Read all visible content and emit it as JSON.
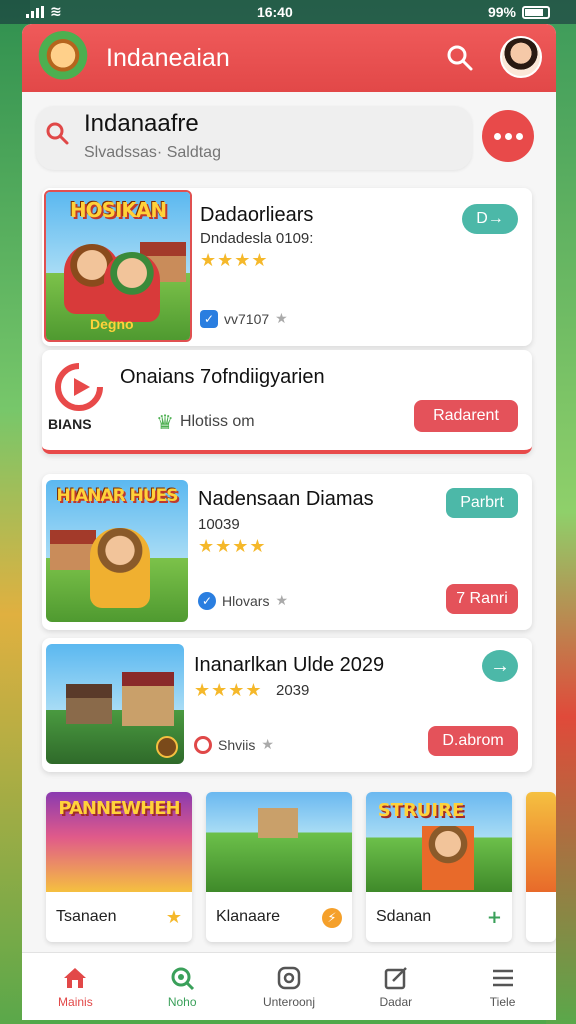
{
  "status": {
    "time": "16:40",
    "battery": "99%"
  },
  "header": {
    "title": "Indaneaian"
  },
  "search": {
    "title": "Indanaafre",
    "placeholder": "Slvadssas· Saldtag"
  },
  "cards": [
    {
      "banner": "HOSIKAN",
      "badge": "Degno",
      "title": "Dadaorliears",
      "subtitle": "Dndadesla 0109:",
      "rating": 4,
      "meta": "vv7107",
      "button": "D→"
    },
    {
      "logo_text": "BIANS",
      "title": "Onaians 7ofndiigyarien",
      "meta": "Hlotiss om",
      "button": "Radarent"
    },
    {
      "banner": "HIANAR HUES",
      "title": "Nadensaan Diamas",
      "subtitle": "10039",
      "rating": 4,
      "meta": "Hlovars",
      "button_top": "Parbrt",
      "button_bottom": "7 Ranri"
    },
    {
      "title": "Inanarlkan Ulde 2029",
      "subtitle": "2039",
      "rating": 4,
      "meta": "Shviis",
      "button_top": "→",
      "button_bottom": "D.abrom"
    }
  ],
  "tiles": [
    {
      "banner": "PANNEWHEH",
      "label": "Tsanaen",
      "icon": "star-icon"
    },
    {
      "label": "Klanaare",
      "icon": "bolt-icon"
    },
    {
      "banner": "STRUIRE",
      "label": "Sdanan",
      "icon": "plus-icon"
    }
  ],
  "nav": [
    {
      "label": "Mainis",
      "icon": "home-icon"
    },
    {
      "label": "Noho",
      "icon": "search-icon"
    },
    {
      "label": "Unteroonj",
      "icon": "record-icon"
    },
    {
      "label": "Dadar",
      "icon": "edit-icon"
    },
    {
      "label": "Tiele",
      "icon": "menu-icon"
    }
  ]
}
